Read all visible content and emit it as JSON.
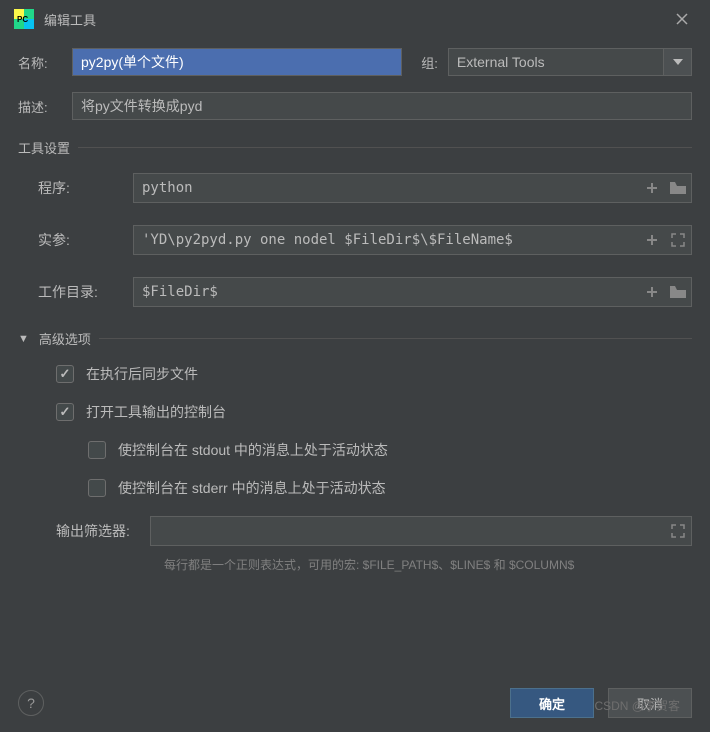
{
  "window": {
    "title": "编辑工具"
  },
  "form": {
    "name_label": "名称:",
    "name_value": "py2py(单个文件)",
    "group_label": "组:",
    "group_value": "External Tools",
    "desc_label": "描述:",
    "desc_value": "将py文件转换成pyd"
  },
  "tool_settings": {
    "section_title": "工具设置",
    "program_label": "程序:",
    "program_value": "python",
    "args_label": "实参:",
    "args_value": "'YD\\py2pyd.py one nodel $FileDir$\\$FileName$",
    "workdir_label": "工作目录:",
    "workdir_value": "$FileDir$"
  },
  "advanced": {
    "section_title": "高级选项",
    "sync_label": "在执行后同步文件",
    "sync_checked": true,
    "console_label": "打开工具输出的控制台",
    "console_checked": true,
    "stdout_label": "使控制台在 stdout 中的消息上处于活动状态",
    "stdout_checked": false,
    "stderr_label": "使控制台在 stderr 中的消息上处于活动状态",
    "stderr_checked": false,
    "output_filter_label": "输出筛选器:",
    "output_filter_value": "",
    "hint": "每行都是一个正则表达式，可用的宏: $FILE_PATH$、$LINE$ 和 $COLUMN$"
  },
  "footer": {
    "ok_label": "确定",
    "cancel_label": "取消"
  },
  "watermark": "CSDN @李贺客"
}
